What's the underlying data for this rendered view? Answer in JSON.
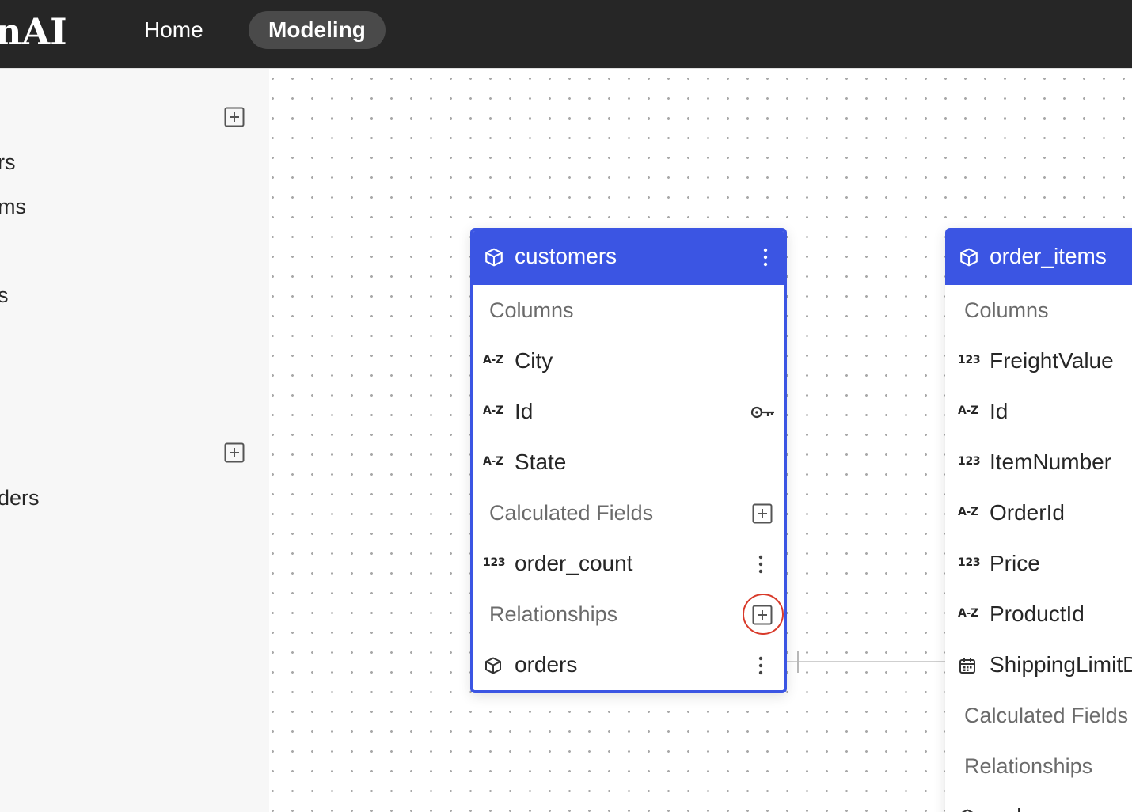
{
  "topbar": {
    "logo": "nAI",
    "nav": [
      {
        "label": "Home",
        "active": false
      },
      {
        "label": "Modeling",
        "active": true
      }
    ]
  },
  "sidebar": {
    "texts": [
      "rs",
      "ms",
      "s",
      "ders"
    ]
  },
  "models": [
    {
      "title": "customers",
      "columns_label": "Columns",
      "columns": [
        {
          "type": "A-Z",
          "name": "City"
        },
        {
          "type": "A-Z",
          "name": "Id",
          "primary_key": true
        },
        {
          "type": "A-Z",
          "name": "State"
        }
      ],
      "calculated_label": "Calculated Fields",
      "calculated": [
        {
          "type": "123",
          "name": "order_count"
        }
      ],
      "relationships_label": "Relationships",
      "relationships": [
        {
          "name": "orders"
        }
      ]
    },
    {
      "title": "order_items",
      "columns_label": "Columns",
      "columns": [
        {
          "type": "123",
          "name": "FreightValue"
        },
        {
          "type": "A-Z",
          "name": "Id"
        },
        {
          "type": "123",
          "name": "ItemNumber"
        },
        {
          "type": "A-Z",
          "name": "OrderId"
        },
        {
          "type": "123",
          "name": "Price"
        },
        {
          "type": "A-Z",
          "name": "ProductId"
        },
        {
          "type": "date",
          "name": "ShippingLimitD"
        }
      ],
      "calculated_label": "Calculated Fields",
      "relationships_label": "Relationships",
      "relationships": [
        {
          "name": "orders"
        }
      ]
    }
  ],
  "colors": {
    "accent": "#3b55e3",
    "highlight_ring": "#d83a2a",
    "topbar": "#262626"
  }
}
